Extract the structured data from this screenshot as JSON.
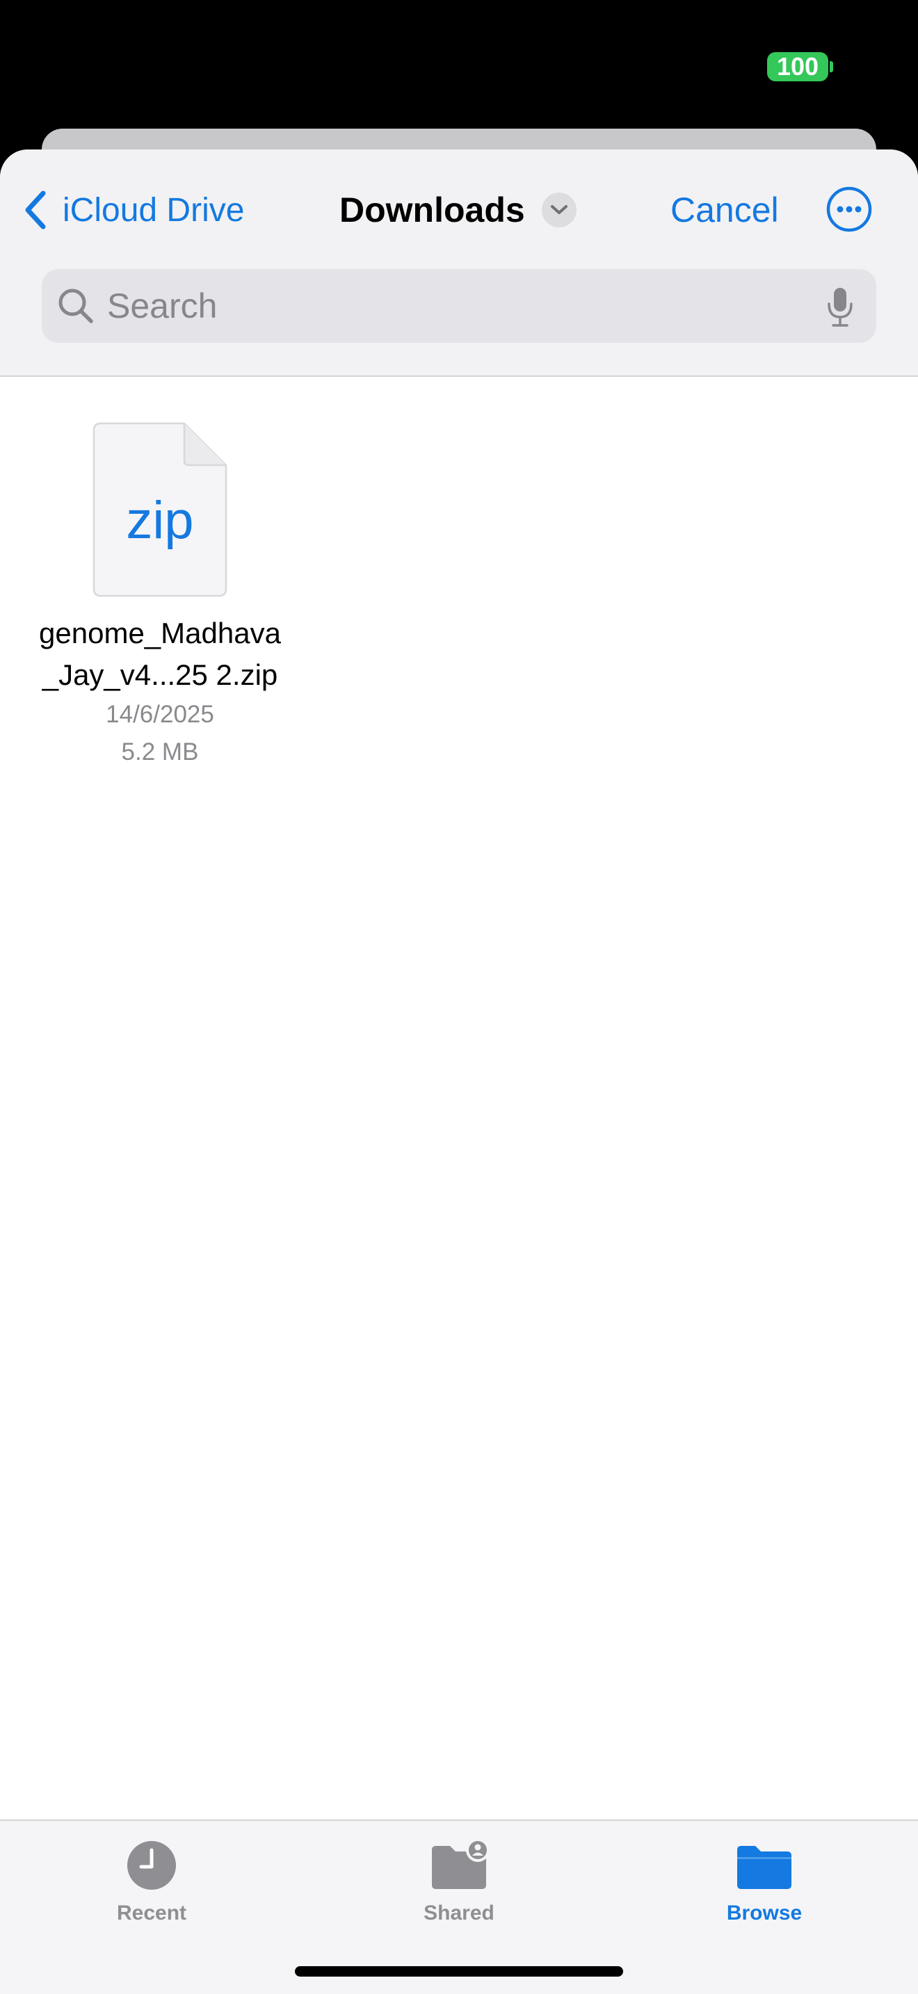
{
  "status_bar": {
    "battery_level": "100",
    "battery_color": "#34C759"
  },
  "nav": {
    "back_label": "iCloud Drive",
    "title": "Downloads",
    "cancel_label": "Cancel"
  },
  "search": {
    "placeholder": "Search",
    "value": ""
  },
  "files": [
    {
      "icon_label": "zip",
      "name_line1": "genome_Madhava",
      "name_line2": "_Jay_v4...25 2.zip",
      "date": "14/6/2025",
      "size": "5.2 MB"
    }
  ],
  "tabs": [
    {
      "label": "Recent",
      "icon": "clock-icon",
      "active": false
    },
    {
      "label": "Shared",
      "icon": "shared-folder-icon",
      "active": false
    },
    {
      "label": "Browse",
      "icon": "folder-icon",
      "active": true
    }
  ],
  "colors": {
    "accent": "#1479E0",
    "inactive": "#8E8E93"
  }
}
